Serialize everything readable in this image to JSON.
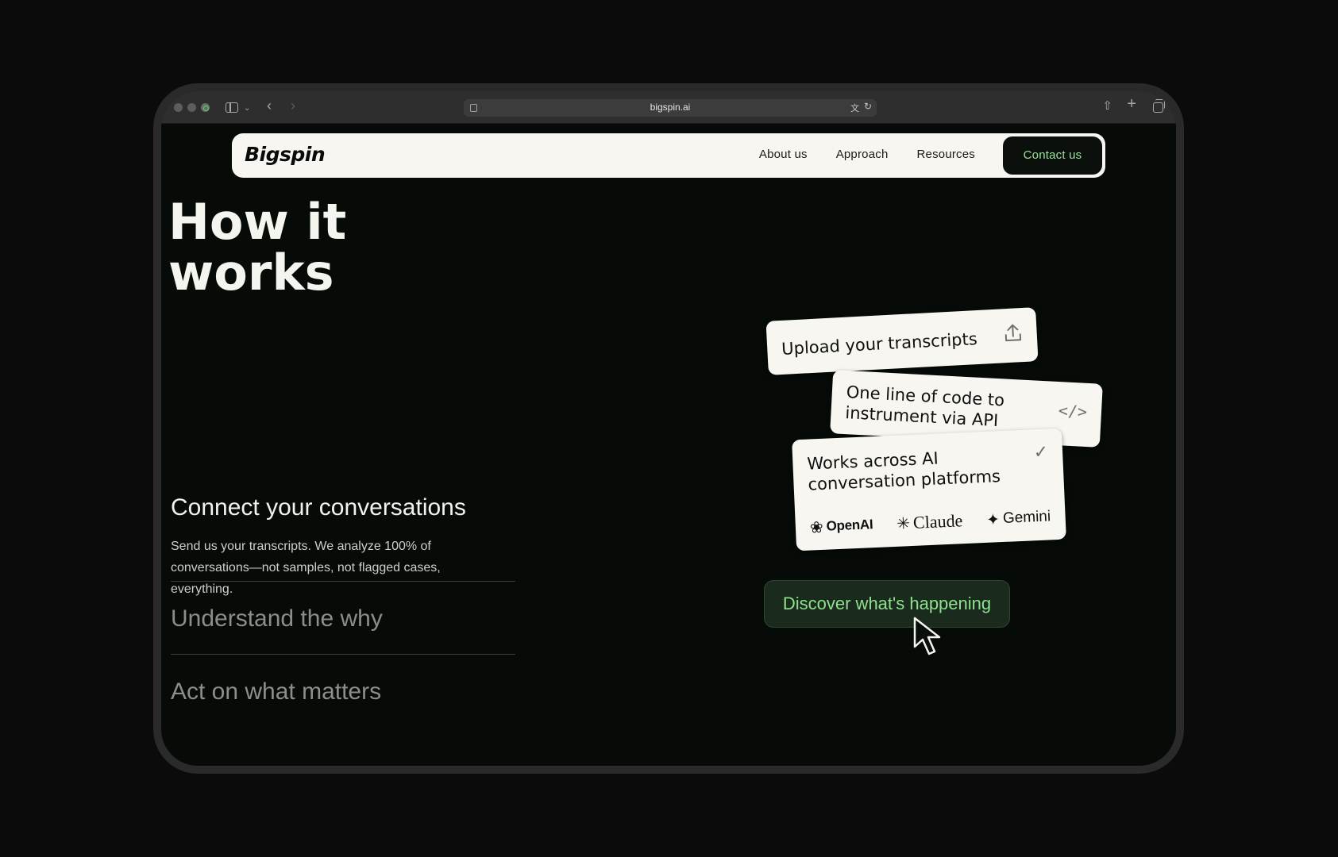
{
  "browser": {
    "url": "bigspin.ai"
  },
  "nav": {
    "logo": "Bigspin",
    "links": [
      "About us",
      "Approach",
      "Resources"
    ],
    "cta": "Contact us"
  },
  "hero": {
    "title_line1": "How it",
    "title_line2": "works"
  },
  "steps": {
    "active_title": "Connect your conversations",
    "active_desc": "Send us your transcripts. We analyze 100% of conversations—not samples, not flagged cases, everything.",
    "collapsed": [
      "Understand the why",
      "Act on what matters"
    ]
  },
  "cards": {
    "upload": "Upload your transcripts",
    "api": "One line of code to instrument via API",
    "platforms": "Works across AI conversation platforms",
    "brands": [
      "OpenAI",
      "Claude",
      "Gemini"
    ]
  },
  "cta": "Discover what's happening",
  "colors": {
    "accent": "#9be39b",
    "background": "#060b07",
    "card": "#f7f6f1"
  }
}
